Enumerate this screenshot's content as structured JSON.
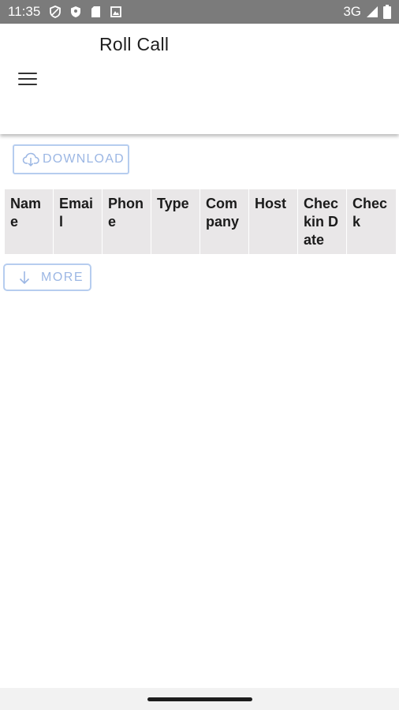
{
  "status_bar": {
    "time": "11:35",
    "network": "3G",
    "icons": [
      "shield-outline-icon",
      "shield-icon",
      "sd-card-icon",
      "image-icon",
      "signal-icon",
      "battery-icon"
    ]
  },
  "app_bar": {
    "title": "Roll Call",
    "menu_icon": "hamburger-menu-icon"
  },
  "toolbar": {
    "download_label": "DOWNLOAD",
    "download_icon": "cloud-download-icon"
  },
  "table": {
    "columns": [
      "Name",
      "Email",
      "Phone",
      "Type",
      "Company",
      "Host",
      "Checkin Date",
      "Check"
    ]
  },
  "more_button": {
    "label": "MORE",
    "icon": "arrow-down-icon"
  },
  "colors": {
    "status_bar_bg": "#7b7b7b",
    "button_border": "#b6cdef",
    "button_text": "#9cb7e4",
    "table_header_bg": "#e9e7e8"
  }
}
